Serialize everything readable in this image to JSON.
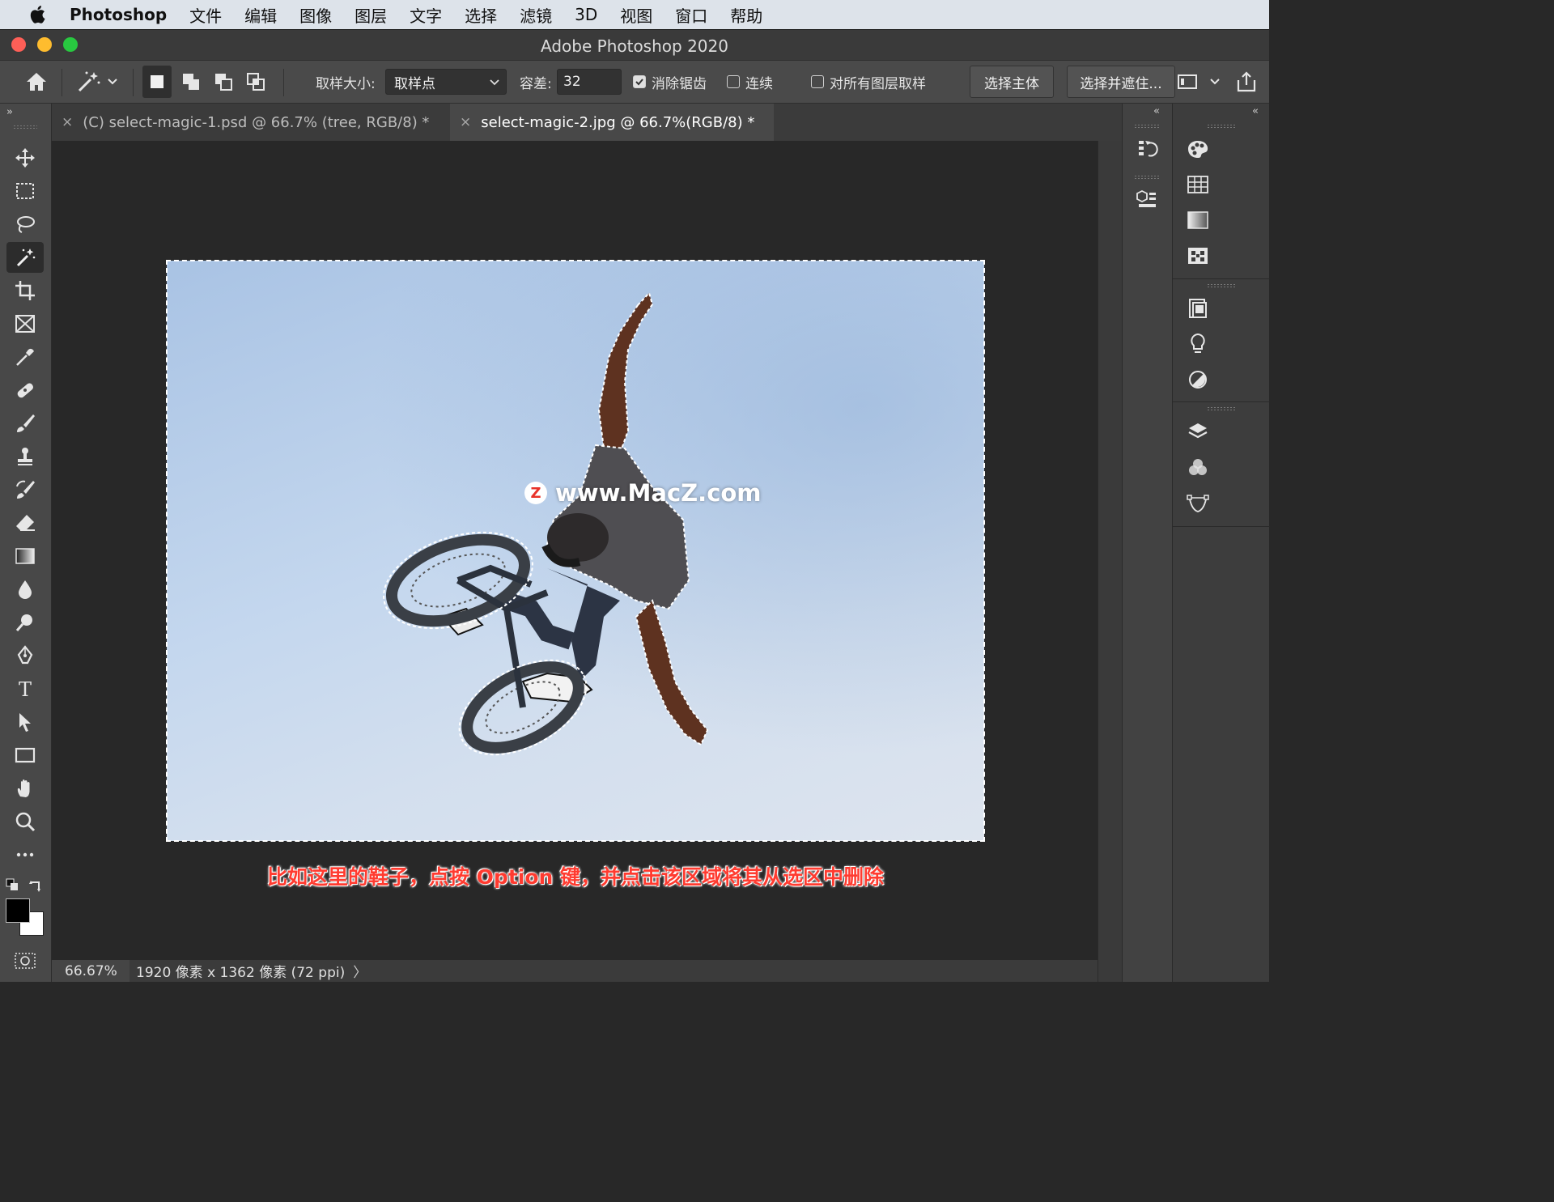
{
  "menubar": {
    "app_name": "Photoshop",
    "items": [
      "文件",
      "编辑",
      "图像",
      "图层",
      "文字",
      "选择",
      "滤镜",
      "3D",
      "视图",
      "窗口",
      "帮助"
    ]
  },
  "window": {
    "title": "Adobe Photoshop 2020"
  },
  "options": {
    "sample_size_label": "取样大小:",
    "sample_size_value": "取样点",
    "tolerance_label": "容差:",
    "tolerance_value": "32",
    "anti_alias_label": "消除锯齿",
    "anti_alias_checked": true,
    "contiguous_label": "连续",
    "contiguous_checked": false,
    "sample_all_layers_label": "对所有图层取样",
    "sample_all_layers_checked": false,
    "select_subject_label": "选择主体",
    "select_and_mask_label": "选择并遮住..."
  },
  "tabs": [
    {
      "label": "(C) select-magic-1.psd @ 66.7% (tree, RGB/8) *",
      "active": false
    },
    {
      "label": "select-magic-2.jpg @ 66.7%(RGB/8) *",
      "active": true
    }
  ],
  "canvas": {
    "watermark": "www.MacZ.com",
    "watermark_badge": "Z",
    "subtitle": "比如这里的鞋子，点按 Option 键，并点击该区域将其从选区中删除"
  },
  "status": {
    "zoom": "66.67%",
    "doc_info": "1920 像素 x 1362 像素 (72 ppi)",
    "arrow": "〉"
  },
  "colors": {
    "accent_subtitle": "#ff3b30",
    "traffic_close": "#fe5f57",
    "traffic_min": "#febc2e",
    "traffic_max": "#28c840"
  }
}
